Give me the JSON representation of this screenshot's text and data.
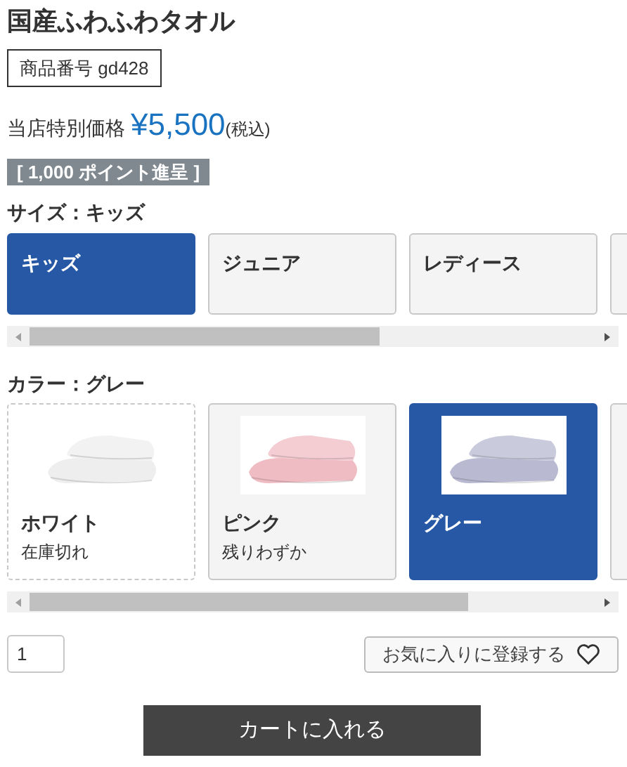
{
  "product": {
    "title": "国産ふわふわタオル",
    "sku": "商品番号 gd428",
    "price_label": "当店特別価格",
    "price": "¥5,500",
    "tax_note": "(税込)",
    "points": "[ 1,000 ポイント進呈 ]"
  },
  "size": {
    "label": "サイズ：キッズ",
    "options": [
      {
        "name": "キッズ",
        "selected": true
      },
      {
        "name": "ジュニア",
        "selected": false
      },
      {
        "name": "レディース",
        "selected": false
      }
    ]
  },
  "color": {
    "label": "カラー：グレー",
    "options": [
      {
        "name": "ホワイト",
        "stock": "在庫切れ",
        "sold_out": true,
        "selected": false,
        "color": "#eeeeee"
      },
      {
        "name": "ピンク",
        "stock": "残りわずか",
        "sold_out": false,
        "selected": false,
        "color": "#f0bcc4"
      },
      {
        "name": "グレー",
        "sold_out": false,
        "selected": true,
        "color": "#b9b9d2"
      }
    ]
  },
  "quantity": {
    "value": "1"
  },
  "favorite_button": "お気に入りに登録する",
  "cart_button": "カートに入れる"
}
